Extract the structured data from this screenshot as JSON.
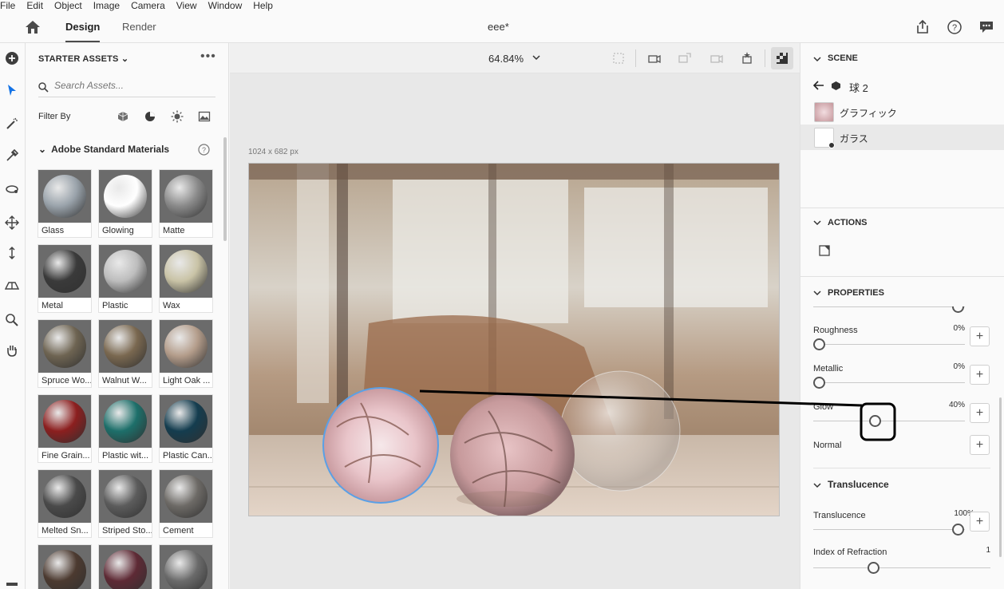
{
  "menu": [
    "File",
    "Edit",
    "Object",
    "Image",
    "Camera",
    "View",
    "Window",
    "Help"
  ],
  "appbar": {
    "tab_design": "Design",
    "tab_render": "Render",
    "doc_title": "eee*"
  },
  "assets": {
    "header": "STARTER ASSETS",
    "search_placeholder": "Search Assets...",
    "filter_label": "Filter By",
    "group_title": "Adobe Standard Materials",
    "materials": [
      {
        "label": "Glass",
        "color": "#9aa3ab"
      },
      {
        "label": "Glowing",
        "color": "#ffffff"
      },
      {
        "label": "Matte",
        "color": "#8a8a8a"
      },
      {
        "label": "Metal",
        "color": "#3a3a3a"
      },
      {
        "label": "Plastic",
        "color": "#bdbdbd"
      },
      {
        "label": "Wax",
        "color": "#c9c3a6"
      },
      {
        "label": "Spruce Wo...",
        "color": "#6e6452"
      },
      {
        "label": "Walnut W...",
        "color": "#7a6850"
      },
      {
        "label": "Light Oak ...",
        "color": "#b39c8a"
      },
      {
        "label": "Fine Grain...",
        "color": "#8c1f1f"
      },
      {
        "label": "Plastic wit...",
        "color": "#1d6f6a"
      },
      {
        "label": "Plastic Can...",
        "color": "#143d4f"
      },
      {
        "label": "Melted Sn...",
        "color": "#4a4a4a"
      },
      {
        "label": "Striped Sto...",
        "color": "#5c5c5c"
      },
      {
        "label": "Cement",
        "color": "#6d6a66"
      },
      {
        "label": "",
        "color": "#4c3a30"
      },
      {
        "label": "",
        "color": "#5e2a35"
      },
      {
        "label": "",
        "color": "#6a6a6a"
      }
    ]
  },
  "canvas": {
    "zoom": "64.84%",
    "size_label": "1024 x 682 px"
  },
  "scene": {
    "title": "SCENE",
    "object_name": "球 2",
    "layers": [
      "グラフィック",
      "ガラス"
    ]
  },
  "actions": {
    "title": "ACTIONS"
  },
  "properties": {
    "title": "PROPERTIES",
    "items": [
      {
        "label": "Roughness",
        "value": "0%",
        "level": 0
      },
      {
        "label": "Metallic",
        "value": "0%",
        "level": 0
      },
      {
        "label": "Glow",
        "value": "40%",
        "level": 0.4
      },
      {
        "label": "Normal",
        "value": "",
        "level": null
      }
    ]
  },
  "translucence": {
    "title": "Translucence",
    "items": [
      {
        "label": "Translucence",
        "value": "100%",
        "level": 1
      },
      {
        "label": "Index of Refraction",
        "value": "1",
        "level": 0.4
      }
    ]
  },
  "colors": {
    "accent": "#1473e6",
    "panel_bg": "#fafafa",
    "canvas_bg": "#e8e8e8"
  }
}
